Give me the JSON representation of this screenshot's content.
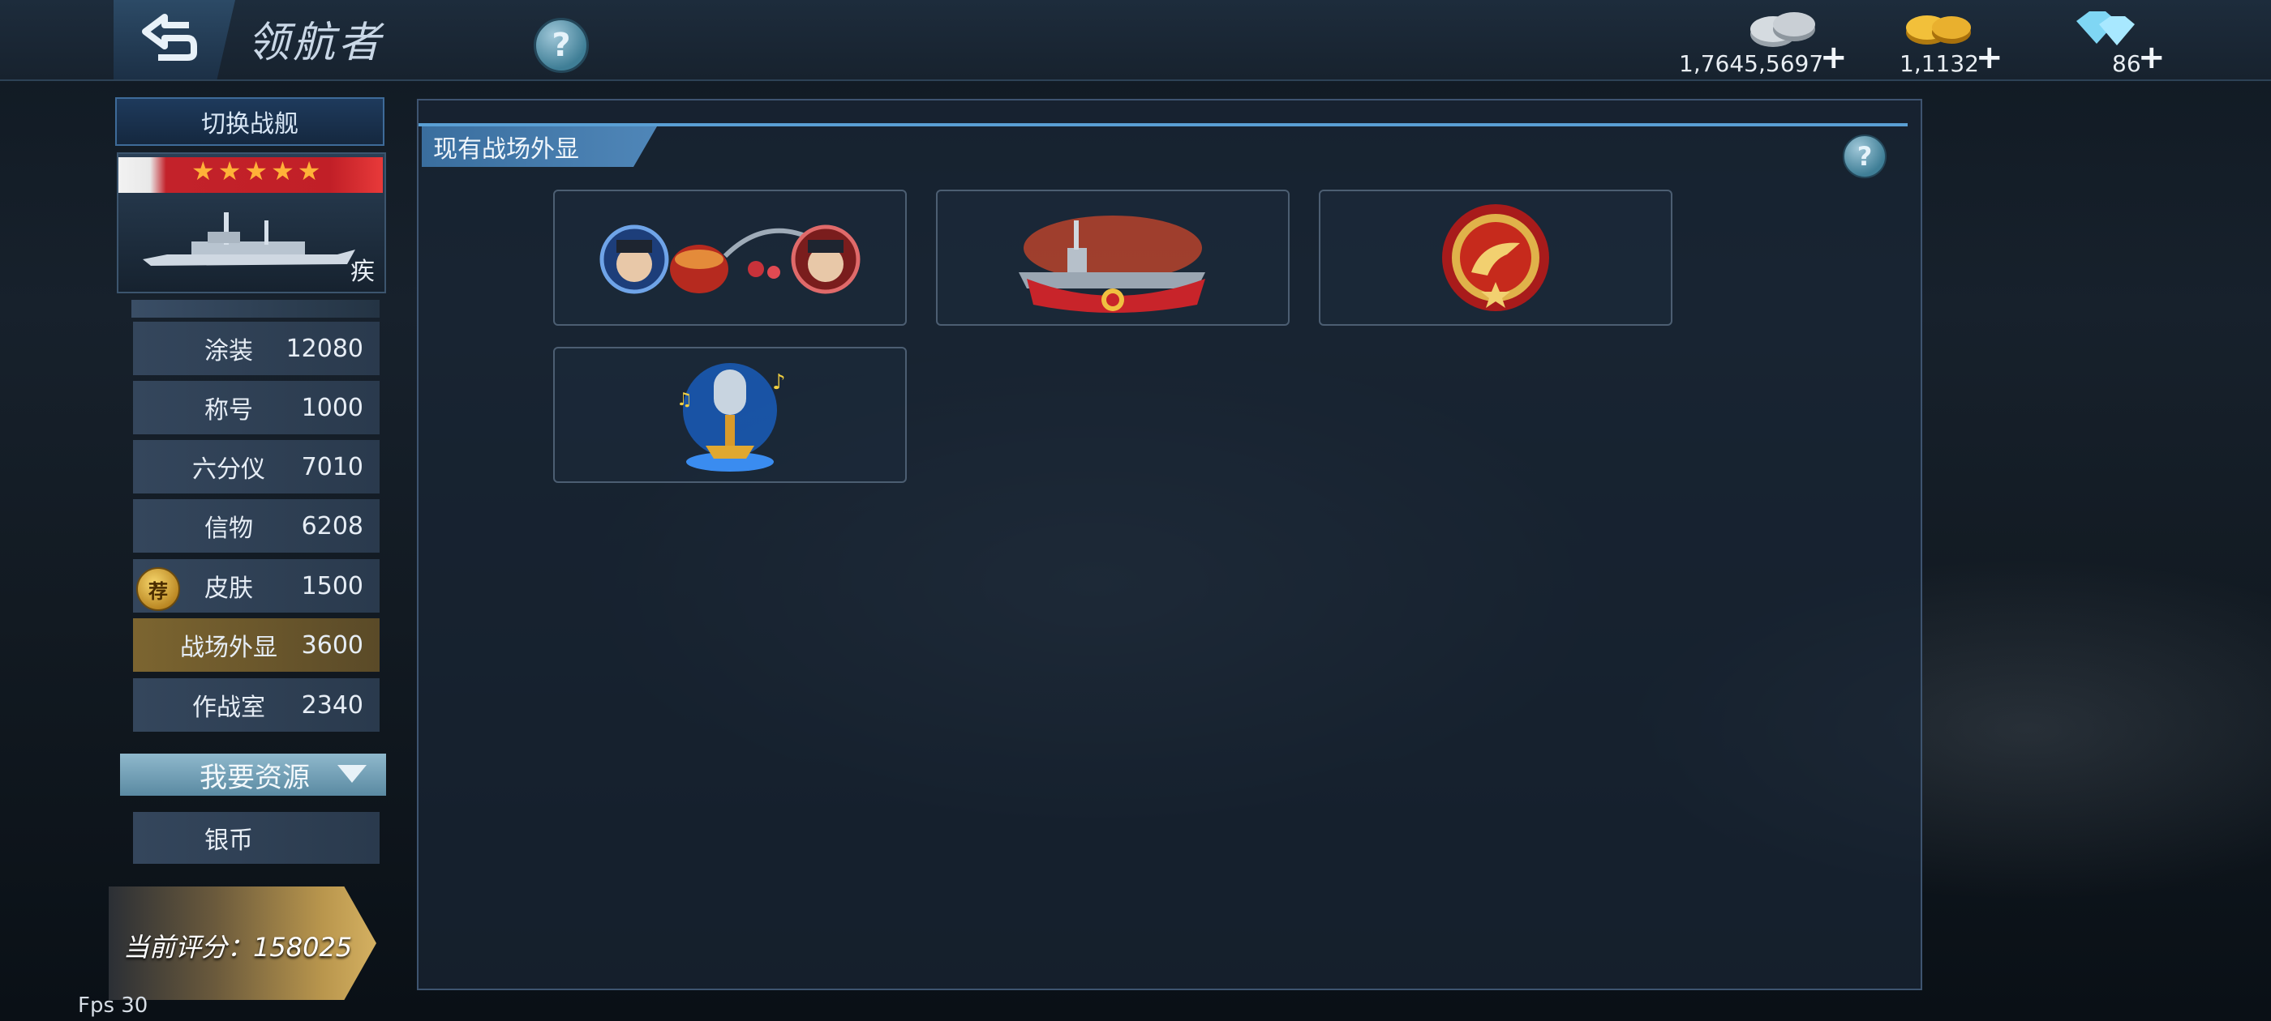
{
  "header": {
    "title": "领航者",
    "back_icon": "back-arrow-icon",
    "help_icon": "question-icon"
  },
  "resources": [
    {
      "name": "silver",
      "icon": "silver-coins-icon",
      "value": "1,7645,5697"
    },
    {
      "name": "gold",
      "icon": "gold-coins-icon",
      "value": "1,1132"
    },
    {
      "name": "diamond",
      "icon": "diamond-icon",
      "value": "86"
    }
  ],
  "sidebar": {
    "switch_label": "切换战舰",
    "ship_class": "疾",
    "stars": "★★★★★",
    "items": [
      {
        "label": "涂装",
        "value": "12080"
      },
      {
        "label": "称号",
        "value": "1000"
      },
      {
        "label": "六分仪",
        "value": "7010"
      },
      {
        "label": "信物",
        "value": "6208"
      },
      {
        "label": "皮肤",
        "value": "1500"
      },
      {
        "label": "战场外显",
        "value": "3600"
      },
      {
        "label": "作战室",
        "value": "2340"
      }
    ],
    "recommend_badge": "荐",
    "want_resources": "我要资源",
    "silver_label": "银币",
    "score": "当前评分：158025"
  },
  "panel": {
    "title": "现有战场外显",
    "slots": [
      {
        "icon": "captains-festival-icon"
      },
      {
        "icon": "aircraft-carrier-banner-icon"
      },
      {
        "icon": "red-gold-medal-icon"
      },
      {
        "icon": "microphone-trophy-icon"
      }
    ]
  },
  "fps": "Fps 30",
  "colors": {
    "accent": "#5a9fd4",
    "active_item": "#7c6530",
    "star": "#ffb238",
    "rank_bar": "#c11f27"
  }
}
